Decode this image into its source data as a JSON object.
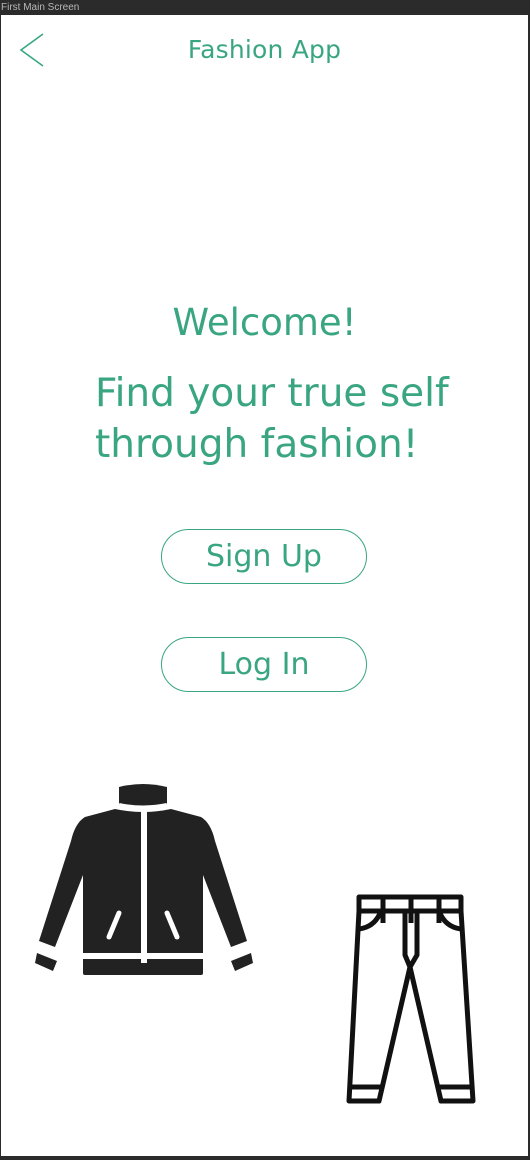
{
  "window": {
    "frame_label": "First Main Screen"
  },
  "header": {
    "title": "Fashion App",
    "back_icon": "chevron-left-icon"
  },
  "main": {
    "welcome": "Welcome!",
    "tagline_line1": "Find your true self",
    "tagline_line2": "through fashion!"
  },
  "actions": {
    "signup_label": "Sign Up",
    "login_label": "Log In"
  },
  "illustrations": {
    "jacket_icon": "jacket-icon",
    "pants_icon": "pants-icon"
  },
  "colors": {
    "accent": "#3aa681",
    "icon": "#222222",
    "background": "#ffffff"
  }
}
